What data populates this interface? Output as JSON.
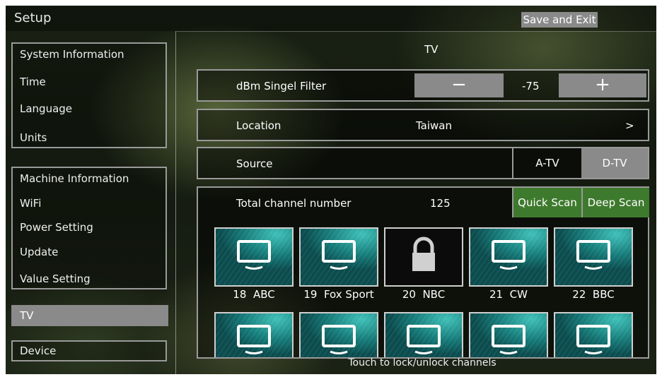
{
  "header": {
    "title": "Setup",
    "save_exit": "Save and Exit"
  },
  "sidebar": {
    "group1": [
      "System Information",
      "Time",
      "Language",
      "Units"
    ],
    "group2": [
      "Machine Information",
      "WiFi",
      "Power Setting",
      "Update",
      "Value Setting"
    ],
    "selected": "TV",
    "device": "Device"
  },
  "panel": {
    "title": "TV",
    "filter": {
      "label": "dBm Singel Filter",
      "minus": "−",
      "value": "-75",
      "plus": "+"
    },
    "location": {
      "label": "Location",
      "value": "Taiwan",
      "chevron": ">"
    },
    "source": {
      "label": "Source",
      "options": [
        "A-TV",
        "D-TV"
      ],
      "selected": "D-TV"
    },
    "channels": {
      "label": "Total channel number",
      "count": "125",
      "quick": "Quick Scan",
      "deep": "Deep Scan"
    },
    "tiles": [
      {
        "num": "18",
        "name": "ABC",
        "icon": "tv-icon"
      },
      {
        "num": "19",
        "name": "Fox Sport",
        "icon": "tv-icon"
      },
      {
        "num": "20",
        "name": "NBC",
        "icon": "lock-icon"
      },
      {
        "num": "21",
        "name": "CW",
        "icon": "tv-icon"
      },
      {
        "num": "22",
        "name": "BBC",
        "icon": "tv-icon"
      }
    ],
    "hint": "Touch to lock/unlock channels"
  },
  "colors": {
    "accent_green": "#3e7a2e",
    "button_gray": "#8a8a8a",
    "tile_teal": "#157a78"
  }
}
